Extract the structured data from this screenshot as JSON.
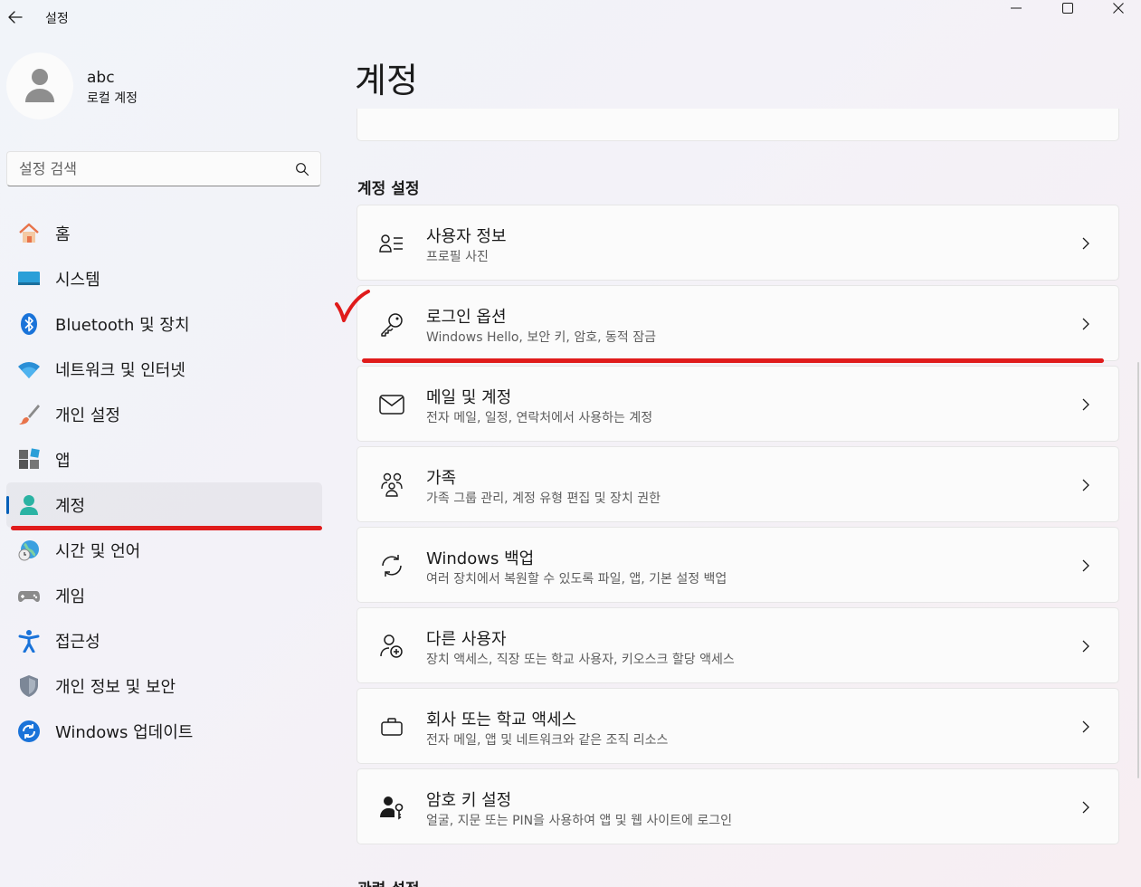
{
  "window": {
    "title": "설정"
  },
  "profile": {
    "name": "abc",
    "account_type": "로컬 계정"
  },
  "search": {
    "placeholder": "설정 검색"
  },
  "sidebar": {
    "items": [
      {
        "label": "홈",
        "icon": "home-icon"
      },
      {
        "label": "시스템",
        "icon": "system-icon"
      },
      {
        "label": "Bluetooth 및 장치",
        "icon": "bluetooth-icon"
      },
      {
        "label": "네트워크 및 인터넷",
        "icon": "wifi-icon"
      },
      {
        "label": "개인 설정",
        "icon": "brush-icon"
      },
      {
        "label": "앱",
        "icon": "apps-icon"
      },
      {
        "label": "계정",
        "icon": "account-icon",
        "active": true
      },
      {
        "label": "시간 및 언어",
        "icon": "time-language-icon"
      },
      {
        "label": "게임",
        "icon": "gamepad-icon"
      },
      {
        "label": "접근성",
        "icon": "accessibility-icon"
      },
      {
        "label": "개인 정보 및 보안",
        "icon": "shield-icon"
      },
      {
        "label": "Windows 업데이트",
        "icon": "update-icon"
      }
    ]
  },
  "main": {
    "title": "계정",
    "section_title": "계정 설정",
    "related_title": "관련 설정",
    "settings": [
      {
        "title": "사용자 정보",
        "subtitle": "프로필 사진",
        "icon": "user-info-icon"
      },
      {
        "title": "로그인 옵션",
        "subtitle": "Windows Hello, 보안 키, 암호, 동적 잠금",
        "icon": "key-icon"
      },
      {
        "title": "메일 및 계정",
        "subtitle": "전자 메일, 일정, 연락처에서 사용하는 계정",
        "icon": "mail-icon"
      },
      {
        "title": "가족",
        "subtitle": "가족 그룹 관리, 계정 유형 편집 및 장치 권한",
        "icon": "family-icon"
      },
      {
        "title": "Windows 백업",
        "subtitle": "여러 장치에서 복원할 수 있도록 파일, 앱, 기본 설정 백업",
        "icon": "backup-icon"
      },
      {
        "title": "다른 사용자",
        "subtitle": "장치 액세스, 직장 또는 학교 사용자, 키오스크 할당 액세스",
        "icon": "add-user-icon"
      },
      {
        "title": "회사 또는 학교 액세스",
        "subtitle": "전자 메일, 앱 및 네트워크와 같은 조직 리소스",
        "icon": "briefcase-icon"
      },
      {
        "title": "암호 키 설정",
        "subtitle": "얼굴, 지문 또는 PIN을 사용하여 앱 및 웹 사이트에 로그인",
        "icon": "passkey-icon"
      }
    ]
  },
  "colors": {
    "accent": "#005fb8",
    "annotation_red": "#e01b1b"
  }
}
